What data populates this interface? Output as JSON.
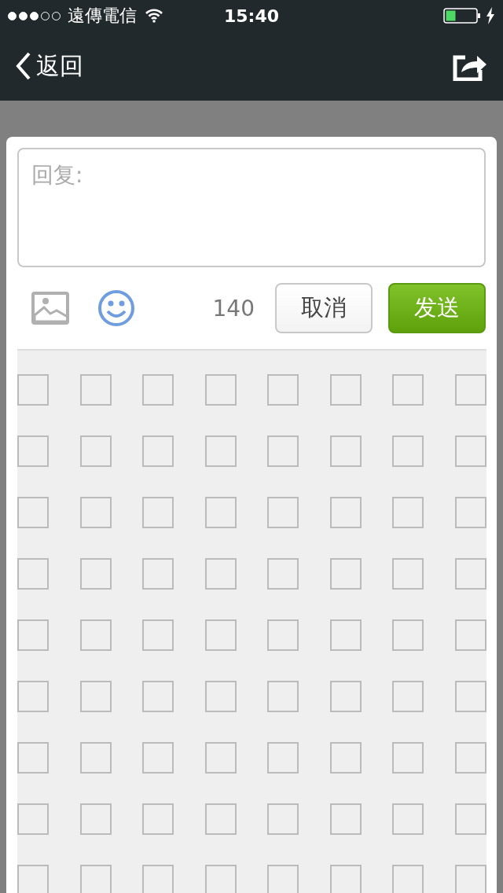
{
  "status_bar": {
    "signal": [
      {
        "filled": true
      },
      {
        "filled": true
      },
      {
        "filled": true
      },
      {
        "filled": false
      },
      {
        "filled": false
      }
    ],
    "carrier": "遠傳電信",
    "time": "15:40",
    "charging": true
  },
  "nav_bar": {
    "back_label": "返回"
  },
  "reply_dialog": {
    "placeholder": "回复:",
    "counter": "140",
    "cancel": "取消",
    "send": "发送",
    "emoji_rows": [
      {
        "cells": [
          {
            "kind": "blank"
          },
          {
            "kind": "blank"
          },
          {
            "kind": "blank"
          },
          {
            "kind": "blank"
          },
          {
            "kind": "blank"
          },
          {
            "kind": "blank"
          },
          {
            "kind": "blank"
          },
          {
            "kind": "blank"
          }
        ]
      },
      {
        "cells": [
          {
            "kind": "blank"
          },
          {
            "kind": "blank"
          },
          {
            "kind": "blank"
          },
          {
            "kind": "blank"
          },
          {
            "kind": "blank"
          },
          {
            "kind": "blank"
          },
          {
            "kind": "blank"
          },
          {
            "kind": "blank"
          }
        ]
      },
      {
        "cells": [
          {
            "kind": "blank"
          },
          {
            "kind": "blank"
          },
          {
            "kind": "blank"
          },
          {
            "kind": "blank"
          },
          {
            "kind": "blank"
          },
          {
            "kind": "blank"
          },
          {
            "kind": "blank"
          },
          {
            "kind": "blank"
          }
        ]
      },
      {
        "cells": [
          {
            "kind": "blank"
          },
          {
            "kind": "blank"
          },
          {
            "kind": "blank"
          },
          {
            "kind": "blank"
          },
          {
            "kind": "blank"
          },
          {
            "kind": "blank"
          },
          {
            "kind": "blank"
          },
          {
            "kind": "blank"
          }
        ]
      },
      {
        "cells": [
          {
            "kind": "blank"
          },
          {
            "kind": "blank"
          },
          {
            "kind": "blank"
          },
          {
            "kind": "blank"
          },
          {
            "kind": "blank"
          },
          {
            "kind": "blank"
          },
          {
            "kind": "blank"
          },
          {
            "kind": "blank"
          }
        ]
      },
      {
        "cells": [
          {
            "kind": "blank"
          },
          {
            "kind": "blank"
          },
          {
            "kind": "blank"
          },
          {
            "kind": "blank"
          },
          {
            "kind": "blank"
          },
          {
            "kind": "blank"
          },
          {
            "kind": "blank"
          },
          {
            "kind": "blank"
          }
        ]
      },
      {
        "cells": [
          {
            "kind": "blank"
          },
          {
            "kind": "blank"
          },
          {
            "kind": "blank"
          },
          {
            "kind": "blank"
          },
          {
            "kind": "blank"
          },
          {
            "kind": "blank"
          },
          {
            "kind": "blank"
          },
          {
            "kind": "blank"
          }
        ]
      },
      {
        "cells": [
          {
            "kind": "blank"
          },
          {
            "kind": "blank"
          },
          {
            "kind": "blank"
          },
          {
            "kind": "blank"
          },
          {
            "kind": "blank"
          },
          {
            "kind": "blank"
          },
          {
            "kind": "blank"
          },
          {
            "kind": "blank"
          }
        ]
      },
      {
        "cells": [
          {
            "kind": "blank"
          },
          {
            "kind": "blank"
          },
          {
            "kind": "blank"
          },
          {
            "kind": "blank"
          },
          {
            "kind": "blank"
          },
          {
            "kind": "blank"
          },
          {
            "kind": "blank"
          },
          {
            "kind": "blank"
          }
        ]
      }
    ]
  }
}
